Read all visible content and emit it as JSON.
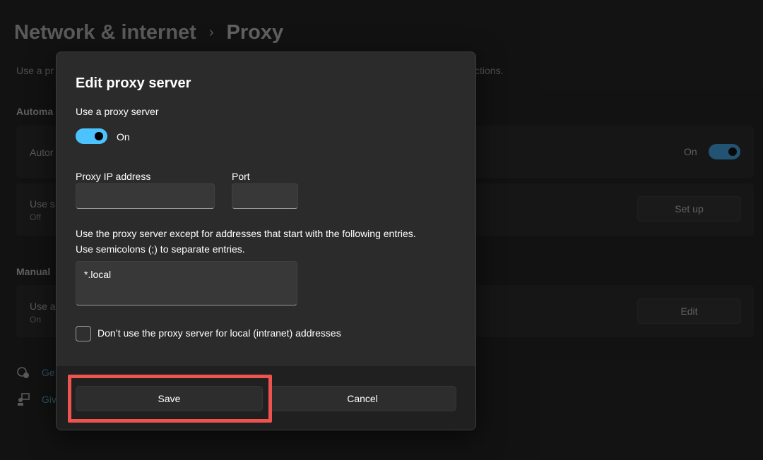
{
  "background": {
    "breadcrumb": {
      "parent": "Network & internet",
      "separator": "›",
      "current": "Proxy"
    },
    "description_start": "Use a pr",
    "description_end": "ctions.",
    "automatic_section_title": "Automa",
    "auto_card": {
      "label": "Autor",
      "toggle_state": "On"
    },
    "script_card": {
      "label": "Use s",
      "sub": "Off",
      "button": "Set up"
    },
    "manual_section_title": "Manual",
    "manual_card": {
      "label": "Use a",
      "sub": "On",
      "button": "Edit"
    },
    "help_links": [
      {
        "label": "Ge",
        "icon": "help-icon"
      },
      {
        "label": "Giv",
        "icon": "feedback-icon"
      }
    ]
  },
  "dialog": {
    "title": "Edit proxy server",
    "use_proxy_label": "Use a proxy server",
    "toggle_state": "On",
    "ip_label": "Proxy IP address",
    "ip_value": "",
    "port_label": "Port",
    "port_value": "",
    "exceptions_note_line1": "Use the proxy server except for addresses that start with the following entries.",
    "exceptions_note_line2": "Use semicolons (;) to separate entries.",
    "exceptions_value": "*.local",
    "local_checkbox_label": "Don’t use the proxy server for local (intranet) addresses",
    "save_label": "Save",
    "cancel_label": "Cancel"
  },
  "colors": {
    "accent": "#4cc2ff",
    "highlight": "#ef5350",
    "dialog_bg": "#2b2b2b"
  }
}
